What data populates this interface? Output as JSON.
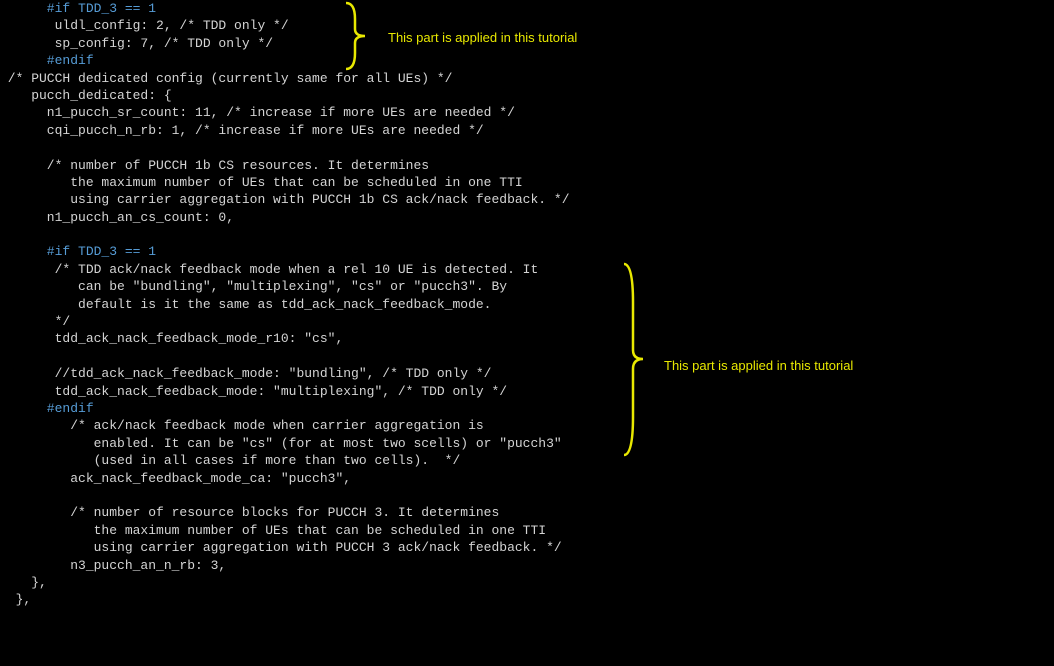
{
  "code": {
    "lines": [
      {
        "indent": "      ",
        "cls": "pp",
        "t": "#if TDD_3 == 1"
      },
      {
        "indent": "       ",
        "cls": "txt",
        "t": "uldl_config: 2, /* TDD only */"
      },
      {
        "indent": "       ",
        "cls": "txt",
        "t": "sp_config: 7, /* TDD only */"
      },
      {
        "indent": "      ",
        "cls": "pp",
        "t": "#endif"
      },
      {
        "indent": " ",
        "cls": "txt",
        "t": "/* PUCCH dedicated config (currently same for all UEs) */"
      },
      {
        "indent": "    ",
        "cls": "txt",
        "t": "pucch_dedicated: {"
      },
      {
        "indent": "      ",
        "cls": "txt",
        "t": "n1_pucch_sr_count: 11, /* increase if more UEs are needed */"
      },
      {
        "indent": "      ",
        "cls": "txt",
        "t": "cqi_pucch_n_rb: 1, /* increase if more UEs are needed */"
      },
      {
        "indent": "",
        "cls": "txt",
        "t": ""
      },
      {
        "indent": "      ",
        "cls": "txt",
        "t": "/* number of PUCCH 1b CS resources. It determines"
      },
      {
        "indent": "         ",
        "cls": "txt",
        "t": "the maximum number of UEs that can be scheduled in one TTI"
      },
      {
        "indent": "         ",
        "cls": "txt",
        "t": "using carrier aggregation with PUCCH 1b CS ack/nack feedback. */"
      },
      {
        "indent": "      ",
        "cls": "txt",
        "t": "n1_pucch_an_cs_count: 0,"
      },
      {
        "indent": "",
        "cls": "txt",
        "t": ""
      },
      {
        "indent": "      ",
        "cls": "pp",
        "t": "#if TDD_3 == 1"
      },
      {
        "indent": "       ",
        "cls": "txt",
        "t": "/* TDD ack/nack feedback mode when a rel 10 UE is detected. It"
      },
      {
        "indent": "          ",
        "cls": "txt",
        "t": "can be \"bundling\", \"multiplexing\", \"cs\" or \"pucch3\". By"
      },
      {
        "indent": "          ",
        "cls": "txt",
        "t": "default is it the same as tdd_ack_nack_feedback_mode."
      },
      {
        "indent": "       ",
        "cls": "txt",
        "t": "*/"
      },
      {
        "indent": "       ",
        "cls": "txt",
        "t": "tdd_ack_nack_feedback_mode_r10: \"cs\","
      },
      {
        "indent": "",
        "cls": "txt",
        "t": ""
      },
      {
        "indent": "       ",
        "cls": "txt",
        "t": "//tdd_ack_nack_feedback_mode: \"bundling\", /* TDD only */"
      },
      {
        "indent": "       ",
        "cls": "txt",
        "t": "tdd_ack_nack_feedback_mode: \"multiplexing\", /* TDD only */"
      },
      {
        "indent": "      ",
        "cls": "pp",
        "t": "#endif"
      },
      {
        "indent": "         ",
        "cls": "txt",
        "t": "/* ack/nack feedback mode when carrier aggregation is"
      },
      {
        "indent": "            ",
        "cls": "txt",
        "t": "enabled. It can be \"cs\" (for at most two scells) or \"pucch3\""
      },
      {
        "indent": "            ",
        "cls": "txt",
        "t": "(used in all cases if more than two cells).  */"
      },
      {
        "indent": "         ",
        "cls": "txt",
        "t": "ack_nack_feedback_mode_ca: \"pucch3\","
      },
      {
        "indent": "",
        "cls": "txt",
        "t": ""
      },
      {
        "indent": "         ",
        "cls": "txt",
        "t": "/* number of resource blocks for PUCCH 3. It determines"
      },
      {
        "indent": "            ",
        "cls": "txt",
        "t": "the maximum number of UEs that can be scheduled in one TTI"
      },
      {
        "indent": "            ",
        "cls": "txt",
        "t": "using carrier aggregation with PUCCH 3 ack/nack feedback. */"
      },
      {
        "indent": "         ",
        "cls": "txt",
        "t": "n3_pucch_an_n_rb: 3,"
      },
      {
        "indent": "    ",
        "cls": "txt",
        "t": "},"
      },
      {
        "indent": "  ",
        "cls": "txt",
        "t": "},"
      }
    ]
  },
  "annotations": {
    "first": "This part is applied in this tutorial",
    "second": "This part is applied in this tutorial"
  }
}
